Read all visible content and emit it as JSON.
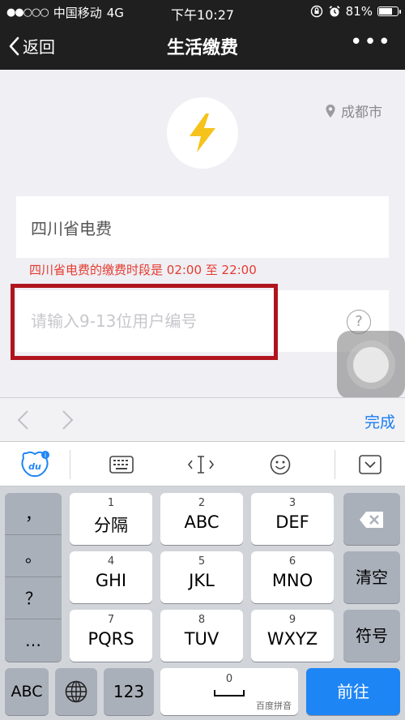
{
  "status_bar": {
    "carrier": "中国移动",
    "network": "4G",
    "time": "下午10:27",
    "battery": "81%",
    "battery_level": 0.81
  },
  "nav": {
    "back_label": "返回",
    "title": "生活缴费",
    "more_label": "•••"
  },
  "main": {
    "city": "成都市",
    "provider": "四川省电费",
    "notice": "四川省电费的缴费时段是 02:00 至 22:00",
    "account_placeholder": "请输入9-13位用户编号",
    "help_label": "?"
  },
  "accessory": {
    "done_label": "完成"
  },
  "toolbar": {
    "icons": [
      "du-icon",
      "keyboard-icon",
      "cursor-icon",
      "emoji-icon",
      "collapse-keyboard-icon"
    ]
  },
  "keyboard": {
    "punctuation": [
      "，",
      "。",
      "？",
      "…"
    ],
    "keys": [
      {
        "num": "1",
        "label": "分隔"
      },
      {
        "num": "2",
        "label": "ABC"
      },
      {
        "num": "3",
        "label": "DEF"
      },
      {
        "num": "4",
        "label": "GHI"
      },
      {
        "num": "5",
        "label": "JKL"
      },
      {
        "num": "6",
        "label": "MNO"
      },
      {
        "num": "7",
        "label": "PQRS"
      },
      {
        "num": "8",
        "label": "TUV"
      },
      {
        "num": "9",
        "label": "WXYZ"
      }
    ],
    "clear_label": "清空",
    "symbol_label": "符号",
    "abc_label": "ABC",
    "num_label": "123",
    "space_num": "0",
    "space_brand": "百度拼音",
    "go_label": "前往"
  },
  "colors": {
    "nav_bg": "#1f1f1f",
    "notice_red": "#e63b30",
    "accent_blue": "#1a7cf2",
    "highlight_red": "#b0151e",
    "bolt_yellow": "#f5c31b"
  }
}
